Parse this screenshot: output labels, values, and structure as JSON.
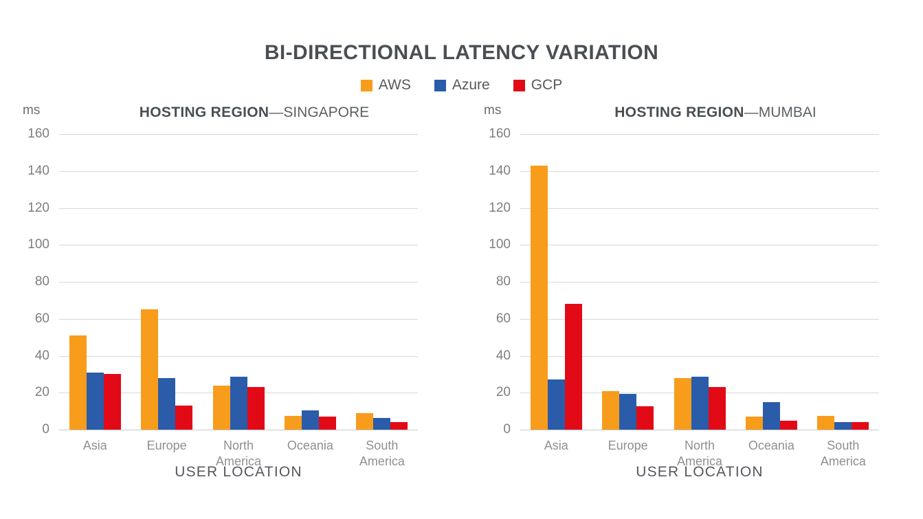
{
  "title": "BI-DIRECTIONAL LATENCY VARIATION",
  "legend": {
    "position": "top-center",
    "items": [
      {
        "label": "AWS",
        "color": "#f89c1c"
      },
      {
        "label": "Azure",
        "color": "#2a5caa"
      },
      {
        "label": "GCP",
        "color": "#e20a17"
      }
    ]
  },
  "panels": [
    {
      "unit": "ms",
      "heading_bold": "HOSTING REGION",
      "heading_light": "—SINGAPORE",
      "xlabel": "USER LOCATION"
    },
    {
      "unit": "ms",
      "heading_bold": "HOSTING REGION",
      "heading_light": "—MUMBAI",
      "xlabel": "USER LOCATION"
    }
  ],
  "chart_data": [
    {
      "type": "bar",
      "title": "HOSTING REGION—SINGAPORE",
      "xlabel": "USER LOCATION",
      "ylabel": "ms",
      "ylim": [
        0,
        160
      ],
      "yticks": [
        160,
        140,
        120,
        100,
        80,
        60,
        40,
        20,
        0
      ],
      "grid": true,
      "categories": [
        "Asia",
        "Europe",
        "North America",
        "Oceania",
        "South America"
      ],
      "series": [
        {
          "name": "AWS",
          "color": "#f89c1c",
          "values": [
            51,
            65,
            24,
            7.5,
            9
          ]
        },
        {
          "name": "Azure",
          "color": "#2a5caa",
          "values": [
            31,
            28,
            28.5,
            10.5,
            6.5
          ]
        },
        {
          "name": "GCP",
          "color": "#e20a17",
          "values": [
            30,
            13,
            23,
            7,
            4
          ]
        }
      ]
    },
    {
      "type": "bar",
      "title": "HOSTING REGION—MUMBAI",
      "xlabel": "USER LOCATION",
      "ylabel": "ms",
      "ylim": [
        0,
        160
      ],
      "yticks": [
        160,
        140,
        120,
        100,
        80,
        60,
        40,
        20,
        0
      ],
      "grid": true,
      "categories": [
        "Asia",
        "Europe",
        "North America",
        "Oceania",
        "South America"
      ],
      "series": [
        {
          "name": "AWS",
          "color": "#f89c1c",
          "values": [
            143,
            21,
            28,
            7,
            7.5
          ]
        },
        {
          "name": "Azure",
          "color": "#2a5caa",
          "values": [
            27,
            19.5,
            28.5,
            15,
            4
          ]
        },
        {
          "name": "GCP",
          "color": "#e20a17",
          "values": [
            68,
            12.5,
            23,
            5,
            4
          ]
        }
      ]
    }
  ]
}
